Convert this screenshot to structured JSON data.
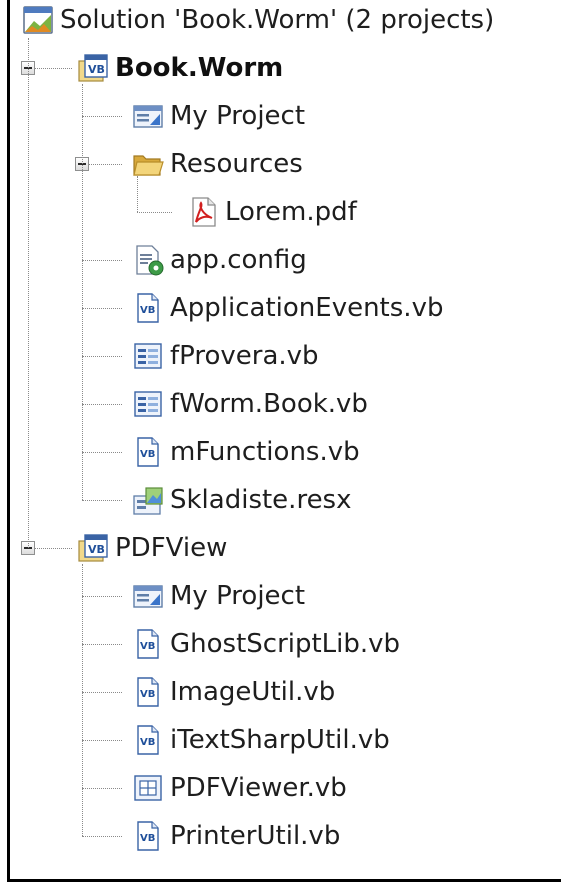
{
  "solution": {
    "label": "Solution 'Book.Worm' (2 projects)",
    "icon": "solution-icon"
  },
  "projects": [
    {
      "name": "Book.Worm",
      "bold": true,
      "icon": "vb-project-icon",
      "expanded": true,
      "items": [
        {
          "label": "My Project",
          "icon": "my-project-icon"
        },
        {
          "label": "Resources",
          "icon": "folder-open-icon",
          "expanded": true,
          "children": [
            {
              "label": "Lorem.pdf",
              "icon": "pdf-file-icon"
            }
          ]
        },
        {
          "label": "app.config",
          "icon": "config-file-icon"
        },
        {
          "label": "ApplicationEvents.vb",
          "icon": "vb-file-icon"
        },
        {
          "label": "fProvera.vb",
          "icon": "vb-form-icon"
        },
        {
          "label": "fWorm.Book.vb",
          "icon": "vb-form-icon"
        },
        {
          "label": "mFunctions.vb",
          "icon": "vb-file-icon"
        },
        {
          "label": "Skladiste.resx",
          "icon": "resx-file-icon"
        }
      ]
    },
    {
      "name": "PDFView",
      "bold": false,
      "icon": "vb-project-icon",
      "expanded": true,
      "items": [
        {
          "label": "My Project",
          "icon": "my-project-icon"
        },
        {
          "label": "GhostScriptLib.vb",
          "icon": "vb-file-icon"
        },
        {
          "label": "ImageUtil.vb",
          "icon": "vb-file-icon"
        },
        {
          "label": "iTextSharpUtil.vb",
          "icon": "vb-file-icon"
        },
        {
          "label": "PDFViewer.vb",
          "icon": "vb-usercontrol-icon"
        },
        {
          "label": "PrinterUtil.vb",
          "icon": "vb-file-icon"
        }
      ]
    }
  ],
  "colors": {
    "tree_line": "#8a8a8a",
    "text": "#1e1e1e",
    "frame": "#000000",
    "vb_blue": "#1f5fae",
    "folder": "#e9c45e",
    "pdf_red": "#d11f1f"
  }
}
